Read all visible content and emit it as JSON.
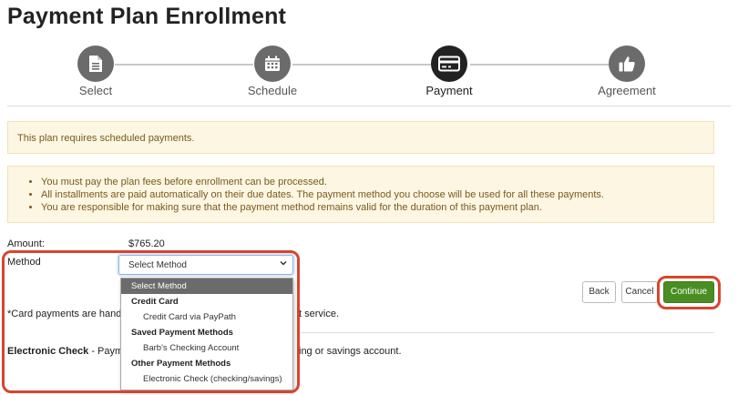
{
  "page": {
    "title": "Payment Plan Enrollment"
  },
  "steps": [
    {
      "label": "Select",
      "icon": "document-icon",
      "state": "complete"
    },
    {
      "label": "Schedule",
      "icon": "calendar-icon",
      "state": "complete"
    },
    {
      "label": "Payment",
      "icon": "credit-card-icon",
      "state": "active"
    },
    {
      "label": "Agreement",
      "icon": "thumbs-up-icon",
      "state": "upcoming"
    }
  ],
  "alerts": {
    "scheduled": "This plan requires scheduled payments.",
    "notes": [
      "You must pay the plan fees before enrollment can be processed.",
      "All installments are paid automatically on their due dates. The payment method you choose will be used for all these payments.",
      "You are responsible for making sure that the payment method remains valid for the duration of this payment plan."
    ]
  },
  "form": {
    "amount_label": "Amount:",
    "amount_value": "$765.20",
    "method_label": "Method",
    "method_selected": "Select Method"
  },
  "dropdown": {
    "placeholder": "Select Method",
    "groups": [
      {
        "label": "Credit Card",
        "options": [
          "Credit Card via PayPath"
        ]
      },
      {
        "label": "Saved Payment Methods",
        "options": [
          "Barb's Checking Account"
        ]
      },
      {
        "label": "Other Payment Methods",
        "options": [
          "Electronic Check (checking/savings)"
        ]
      }
    ]
  },
  "info": {
    "card_note_start": "*Card payments are handl",
    "card_note_end": "t service.",
    "echeck_title": "Electronic Check",
    "echeck_start": " - Payme",
    "echeck_end": "ing or savings account."
  },
  "buttons": {
    "back": "Back",
    "cancel": "Cancel",
    "continue": "Continue"
  },
  "colors": {
    "highlight": "#d9442e",
    "continue": "#4a8d22",
    "alert_bg": "#fcf6e3",
    "active_step": "#222222",
    "step": "#6b6b6b"
  }
}
